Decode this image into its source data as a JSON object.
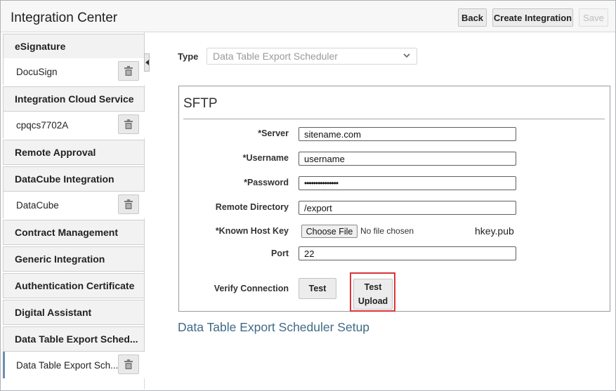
{
  "header": {
    "title": "Integration Center",
    "back_label": "Back",
    "create_label": "Create Integration",
    "save_label": "Save"
  },
  "sidebar": {
    "groups": [
      {
        "label": "eSignature",
        "items": [
          {
            "label": "DocuSign"
          }
        ]
      },
      {
        "label": "Integration Cloud Service",
        "items": [
          {
            "label": "cpqcs7702A"
          }
        ]
      },
      {
        "label": "Remote Approval",
        "items": []
      },
      {
        "label": "DataCube Integration",
        "items": [
          {
            "label": "DataCube"
          }
        ]
      },
      {
        "label": "Contract Management",
        "items": []
      },
      {
        "label": "Generic Integration",
        "items": []
      },
      {
        "label": "Authentication Certificate",
        "items": []
      },
      {
        "label": "Digital Assistant",
        "items": []
      },
      {
        "label": "Data Table Export Sched...",
        "items": [
          {
            "label": "Data Table Export Sch...",
            "active": true
          }
        ]
      }
    ]
  },
  "icons": {
    "trash": "trash-icon",
    "collapse": "chevron-left-icon",
    "select": "chevron-down-icon"
  },
  "form": {
    "type_label": "Type",
    "type_value": "Data Table Export Scheduler",
    "sftp_title": "SFTP",
    "server_label": "*Server",
    "server_value": "sitename.com",
    "username_label": "*Username",
    "username_value": "username",
    "password_label": "*Password",
    "password_value": "•••••••••••••••",
    "remote_dir_label": "Remote Directory",
    "remote_dir_value": "/export",
    "host_key_label": "*Known Host Key",
    "choose_file_label": "Choose File",
    "no_file_text": "No file chosen",
    "host_key_file": "hkey.pub",
    "port_label": "Port",
    "port_value": "22",
    "verify_label": "Verify Connection",
    "test_label": "Test",
    "test_upload_label_1": "Test",
    "test_upload_label_2": "Upload"
  },
  "setup_link": "Data Table Export Scheduler Setup",
  "colors": {
    "highlight": "#d9343a",
    "link": "#3f6a86",
    "active_marker": "#6f8fb0"
  }
}
